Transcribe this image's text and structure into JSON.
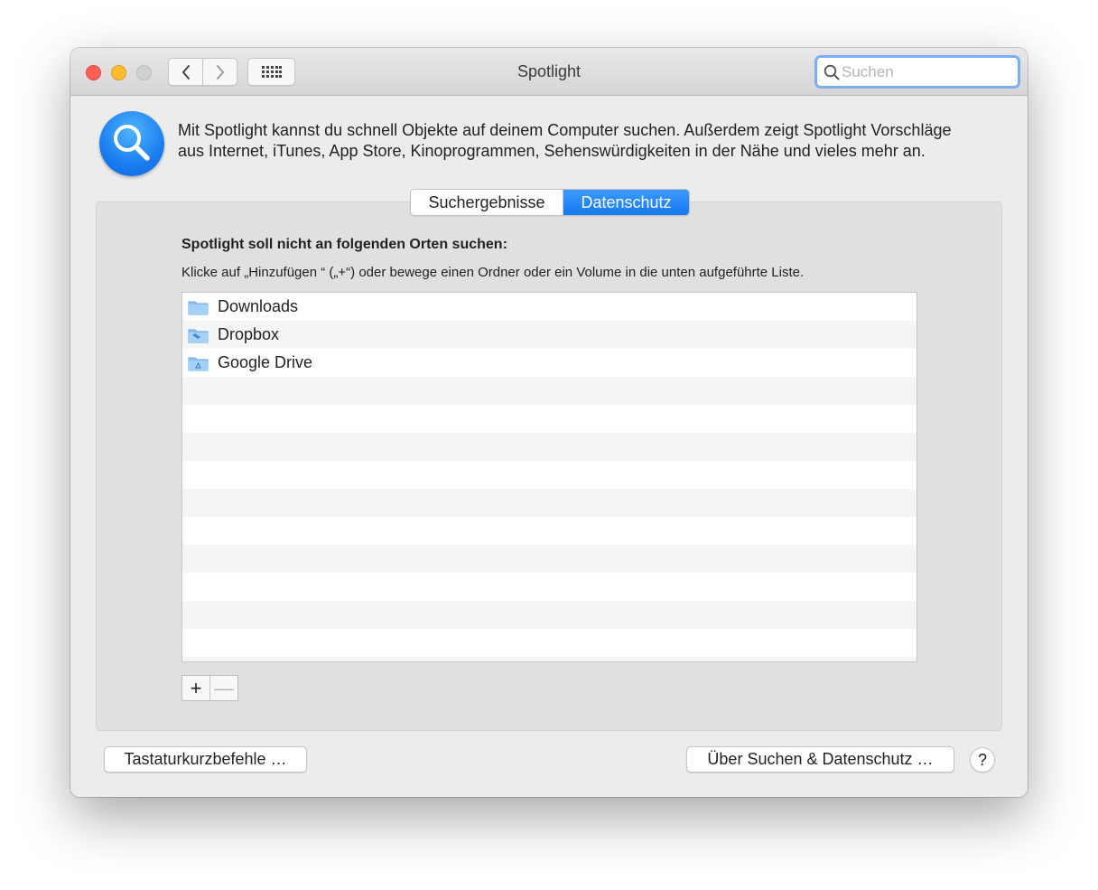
{
  "window": {
    "title": "Spotlight",
    "search_placeholder": "Suchen"
  },
  "intro": {
    "text_line1": "Mit Spotlight kannst du schnell Objekte auf deinem Computer suchen. Außerdem zeigt Spotlight Vorschläge",
    "text_line2": "aus Internet, iTunes, App Store, Kinoprogrammen, Sehenswürdigkeiten in der Nähe und vieles mehr an."
  },
  "tabs": [
    {
      "label": "Suchergebnisse",
      "active": false
    },
    {
      "label": "Datenschutz",
      "active": true
    }
  ],
  "privacy": {
    "heading": "Spotlight soll nicht an folgenden Orten suchen:",
    "instructions": "Klicke auf „Hinzufügen “ („+“) oder bewege einen Ordner oder ein Volume in die unten aufgeführte Liste.",
    "items": [
      {
        "name": "Downloads",
        "icon": "downloads-folder-icon"
      },
      {
        "name": "Dropbox",
        "icon": "dropbox-folder-icon"
      },
      {
        "name": "Google Drive",
        "icon": "google-drive-folder-icon"
      }
    ],
    "add_label": "+",
    "remove_label": "—"
  },
  "footer": {
    "keyboard_button": "Tastaturkurzbefehle …",
    "about_button": "Über Suchen & Datenschutz …",
    "help_label": "?"
  },
  "colors": {
    "accent": "#1479f7",
    "close": "#fd5e56",
    "minimize": "#fdbb2d",
    "zoom_disabled": "#d1d0d1",
    "folder": "#7fb8ee"
  }
}
